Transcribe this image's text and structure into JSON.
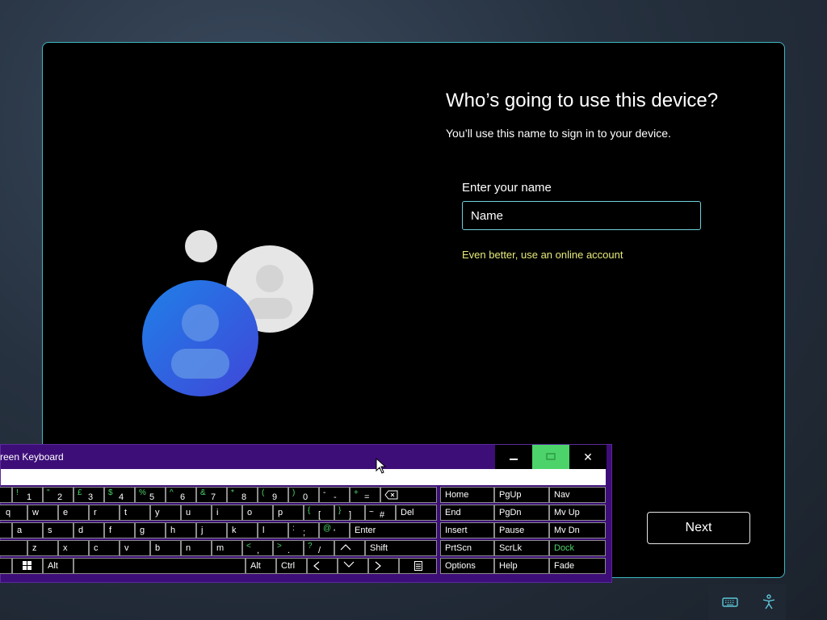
{
  "setup": {
    "title": "Who’s going to use this device?",
    "subtitle": "You’ll use this name to sign in to your device.",
    "field_label": "Enter your name",
    "name_placeholder": "Name",
    "online_link": "Even better, use an online account",
    "next_label": "Next"
  },
  "osk": {
    "title": "reen Keyboard",
    "controls": {
      "minimize": "–",
      "close": "✕"
    },
    "keys": {
      "k1_shift": "!",
      "k1": "1",
      "k2_shift": "\"",
      "k2": "2",
      "k3_shift": "£",
      "k3": "3",
      "k4_shift": "$",
      "k4": "4",
      "k5_shift": "%",
      "k5": "5",
      "k6_shift": "^",
      "k6": "6",
      "k7_shift": "&",
      "k7": "7",
      "k8_shift": "*",
      "k8": "8",
      "k9_shift": "(",
      "k9": "9",
      "k0_shift": ")",
      "k0": "0",
      "minus_shift": "-",
      "minus": "-",
      "equals_shift": "+",
      "equals": "=",
      "q": "q",
      "w": "w",
      "e": "e",
      "r": "r",
      "t": "t",
      "y": "y",
      "u": "u",
      "i": "i",
      "o": "o",
      "p": "p",
      "lbracket_shift": "{",
      "lbracket": "[",
      "rbracket_shift": "}",
      "rbracket": "]",
      "hash_shift": "~",
      "hash": "#",
      "del": "Del",
      "a": "a",
      "s": "s",
      "d": "d",
      "f": "f",
      "g": "g",
      "h": "h",
      "j": "j",
      "k": "k",
      "l": "l",
      "semicolon_shift": ":",
      "semicolon": ";",
      "apos_shift": "@",
      "apos": "'",
      "enter": "Enter",
      "z": "z",
      "x": "x",
      "c": "c",
      "v": "v",
      "b": "b",
      "n": "n",
      "m": "m",
      "comma_shift": "<",
      "comma": ",",
      "period_shift": ">",
      "period": ".",
      "slash_shift": "?",
      "slash": "/",
      "shift": "Shift",
      "alt_left": "Alt",
      "alt_right": "Alt",
      "ctrl": "Ctrl"
    },
    "nav": {
      "home": "Home",
      "pgup": "PgUp",
      "nav": "Nav",
      "end": "End",
      "pgdn": "PgDn",
      "mvup": "Mv Up",
      "insert": "Insert",
      "pause": "Pause",
      "mvdn": "Mv Dn",
      "prtscn": "PrtScn",
      "scrlk": "ScrLk",
      "dock": "Dock",
      "options": "Options",
      "help": "Help",
      "fade": "Fade"
    }
  },
  "colors": {
    "accent_cyan": "#3fb8c4",
    "link_yellow": "#e7ea7a",
    "osk_purple": "#3d0e78",
    "osk_green": "#4cd46a",
    "avatar_blue": "#2f6fe0"
  }
}
